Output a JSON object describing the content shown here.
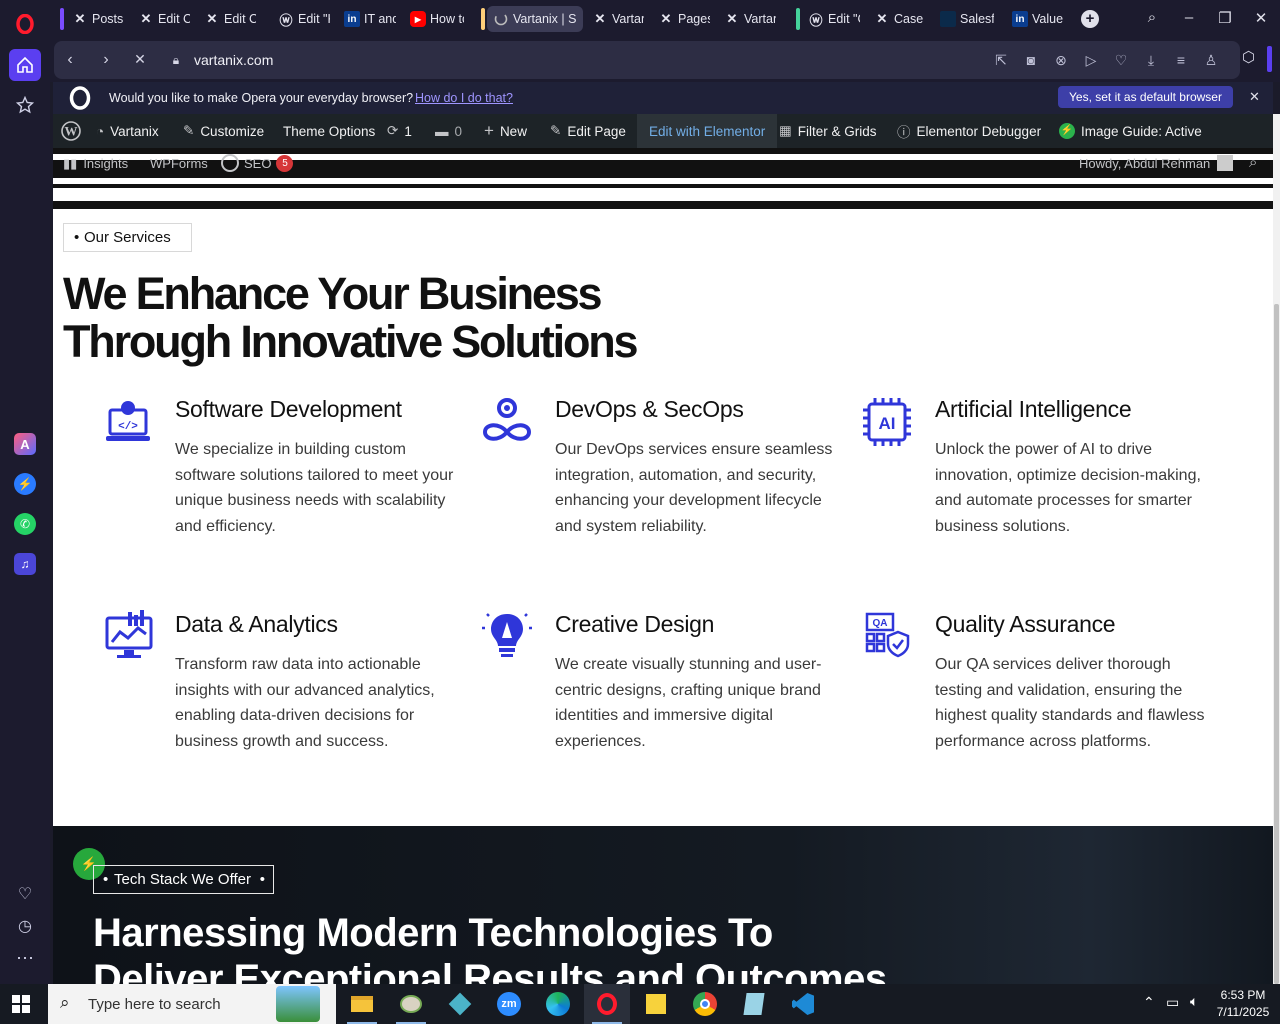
{
  "browser": {
    "tabs": [
      {
        "label": "Posts ‹",
        "icon": "x-logo-icon"
      },
      {
        "label": "Edit Co",
        "icon": "x-logo-icon"
      },
      {
        "label": "Edit Co",
        "icon": "x-logo-icon"
      },
      {
        "label": "Edit \"K",
        "icon": "wordpress-icon"
      },
      {
        "label": "IT and",
        "icon": "linkedin-icon"
      },
      {
        "label": "How to",
        "icon": "youtube-icon"
      },
      {
        "label": "Vartanix | So",
        "icon": "loading-icon"
      },
      {
        "label": "Vartani",
        "icon": "x-logo-icon"
      },
      {
        "label": "Pages",
        "icon": "x-logo-icon"
      },
      {
        "label": "Vartani",
        "icon": "x-logo-icon"
      },
      {
        "label": "Edit \"C",
        "icon": "wordpress-icon"
      },
      {
        "label": "Case st",
        "icon": "x-logo-icon"
      },
      {
        "label": "Salesfo",
        "icon": "site-icon"
      },
      {
        "label": "Value c",
        "icon": "linkedin-icon"
      }
    ],
    "url": "vartanix.com",
    "default_prompt": {
      "question": "Would you like to make Opera your everyday browser?",
      "link": "How do I do that?",
      "button": "Yes, set it as default browser"
    }
  },
  "wp_admin_bar": {
    "site": "Vartanix",
    "customize": "Customize",
    "theme_options": "Theme Options",
    "updates_count": "1",
    "comments_count": "0",
    "new": "New",
    "edit_page": "Edit Page",
    "edit_elementor": "Edit with Elementor",
    "filter_grids": "Filter & Grids",
    "elementor_debugger": "Elementor Debugger",
    "image_guide": "Image Guide: Active",
    "insights": "Insights",
    "wpforms": "WPForms",
    "seo": "SEO",
    "seo_badge": "5",
    "howdy": "Howdy, Abdul Rehman"
  },
  "services_section": {
    "badge": "Our Services",
    "heading_line1": "We Enhance Your Business",
    "heading_line2": "Through Innovative Solutions",
    "items": [
      {
        "title": "Software Development",
        "text": "We specialize in building custom software solutions tailored to meet your unique business needs with scalability and efficiency.",
        "icon": "software-development-icon"
      },
      {
        "title": "DevOps & SecOps",
        "text": "Our DevOps services ensure seamless integration, automation, and security, enhancing your development lifecycle and system reliability.",
        "icon": "devops-icon"
      },
      {
        "title": "Artificial Intelligence",
        "text": "Unlock the power of AI to drive innovation, optimize decision-making, and automate processes for smarter business solutions.",
        "icon": "ai-chip-icon"
      },
      {
        "title": "Data & Analytics",
        "text": "Transform raw data into actionable insights with our advanced analytics, enabling data-driven decisions for business growth and success.",
        "icon": "analytics-icon"
      },
      {
        "title": "Creative Design",
        "text": "We create visually stunning and user-centric designs, crafting unique brand identities and immersive digital experiences.",
        "icon": "creative-design-icon"
      },
      {
        "title": "Quality Assurance",
        "text": "Our QA services deliver thorough testing and validation, ensuring the highest quality standards and flawless performance across platforms.",
        "icon": "qa-icon"
      }
    ]
  },
  "tech_section": {
    "badge": "Tech Stack We Offer",
    "heading_line1": "Harnessing Modern Technologies To",
    "heading_line2": "Deliver Exceptional Results and Outcomes"
  },
  "taskbar": {
    "search_placeholder": "Type here to search",
    "time": "6:53 PM",
    "date": "7/11/2025"
  },
  "colors": {
    "accent": "#2f36d9",
    "opera_red": "#ff1b2d",
    "wp_bar": "#1d2327",
    "elementor_blue": "#72aee6"
  }
}
